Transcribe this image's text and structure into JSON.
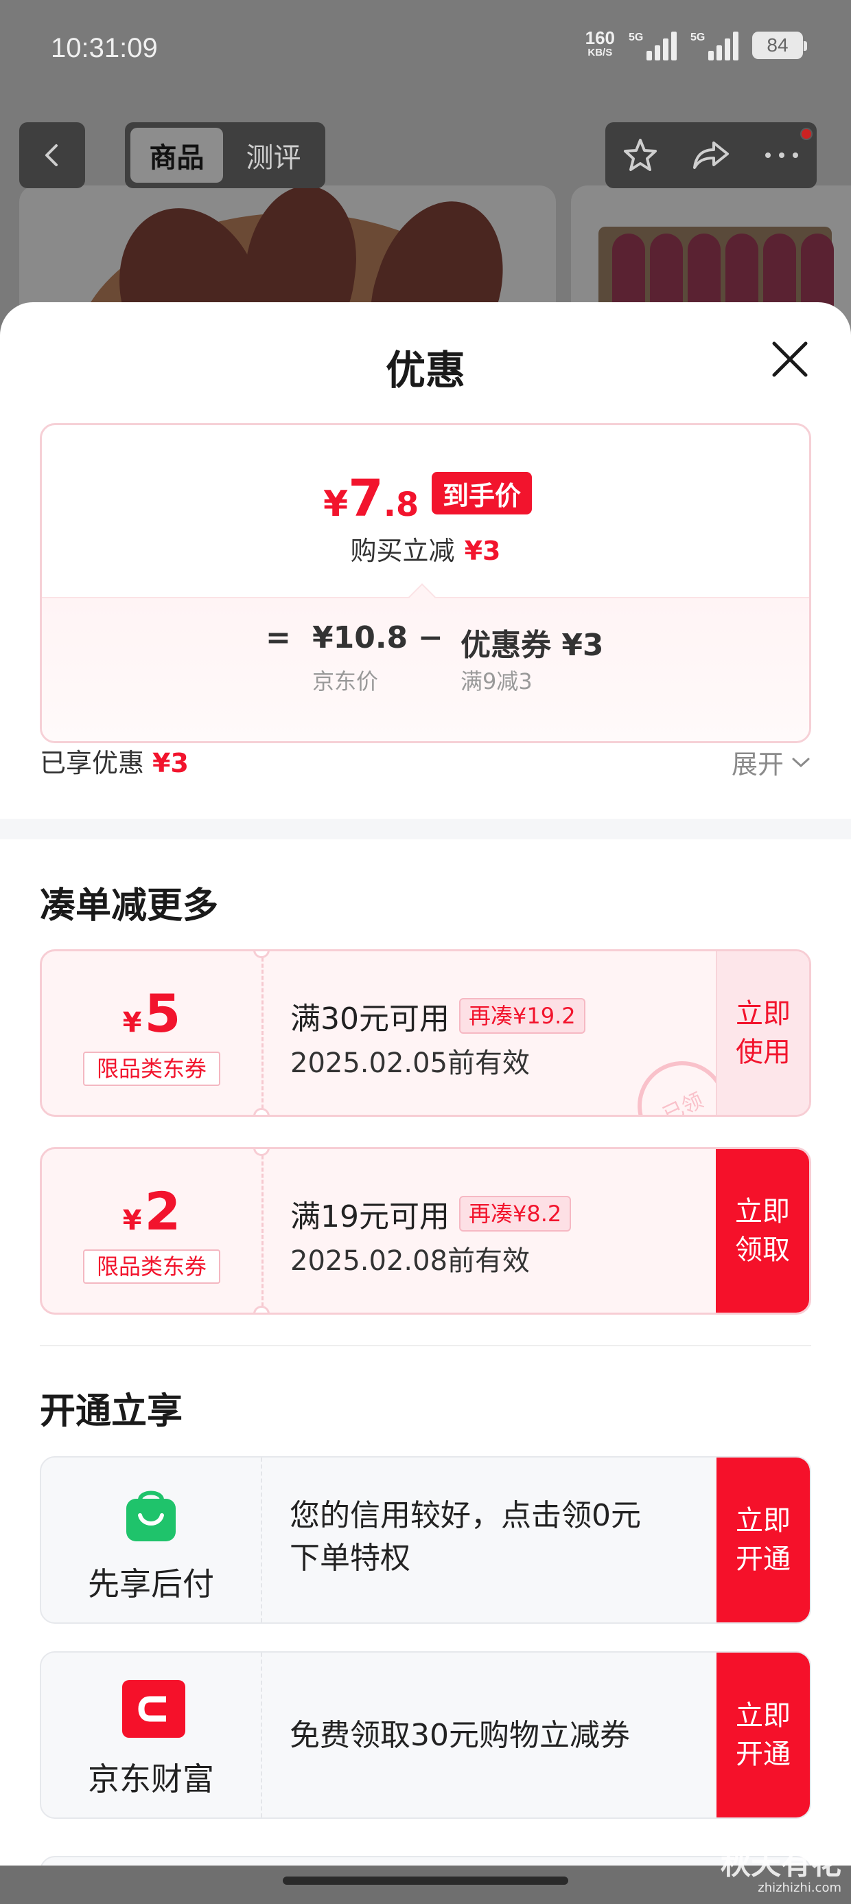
{
  "status_bar": {
    "time": "10:31:09",
    "net_speed": "160",
    "net_unit": "KB/S",
    "signal1_label": "5G",
    "signal2_label": "5G",
    "battery": "84"
  },
  "nav": {
    "tabs": [
      {
        "label": "商品",
        "active": true
      },
      {
        "label": "测评",
        "active": false
      }
    ],
    "icons": [
      "back-icon",
      "star-icon",
      "share-icon",
      "more-icon"
    ]
  },
  "sheet": {
    "title": "优惠",
    "close_icon": "close-icon"
  },
  "price_card": {
    "yen": "¥",
    "final_int": "7",
    "final_dec": ".8",
    "final_tag": "到手价",
    "reduce_label": "购买立减",
    "reduce_amount": "¥3",
    "equals": "=",
    "base_price": "¥10.8",
    "base_label": "京东价",
    "minus": "−",
    "coupon_text": "优惠券 ¥3",
    "coupon_rule": "满9减3"
  },
  "enjoyed": {
    "label": "已享优惠",
    "amount": "¥3",
    "expand_label": "展开"
  },
  "bundle_section": {
    "title": "凑单减更多",
    "coupons": [
      {
        "yen": "¥",
        "amount": "5",
        "badge": "限品类东券",
        "condition": "满30元可用",
        "more": "再凑¥19.2",
        "valid": "2025.02.05前有效",
        "action": "立即使用",
        "action_lines": [
          "立即",
          "使用"
        ],
        "state": "claimed",
        "stamp": "已领"
      },
      {
        "yen": "¥",
        "amount": "2",
        "badge": "限品类东券",
        "condition": "满19元可用",
        "more": "再凑¥8.2",
        "valid": "2025.02.08前有效",
        "action": "立即领取",
        "action_lines": [
          "立即",
          "领取"
        ],
        "state": "unclaimed"
      }
    ]
  },
  "open_section": {
    "title": "开通立享",
    "services": [
      {
        "name": "先享后付",
        "icon": "shopping-bag-icon",
        "desc_lines": [
          "您的信用较好，点击领0元",
          "下单特权"
        ],
        "action_lines": [
          "立即",
          "开通"
        ],
        "color": "#1fc36b"
      },
      {
        "name": "京东财富",
        "icon": "jd-wealth-icon",
        "desc_lines": [
          "免费领取30元购物立减券"
        ],
        "action_lines": [
          "立即",
          "开通"
        ],
        "color": "#f5112a"
      }
    ]
  },
  "watermark": {
    "line1": "秋天有花",
    "line2": "zhizhizhi.com"
  },
  "colors": {
    "accent_red": "#f2142d",
    "button_red": "#f5112a",
    "coupon_bg": "#fff4f5"
  }
}
